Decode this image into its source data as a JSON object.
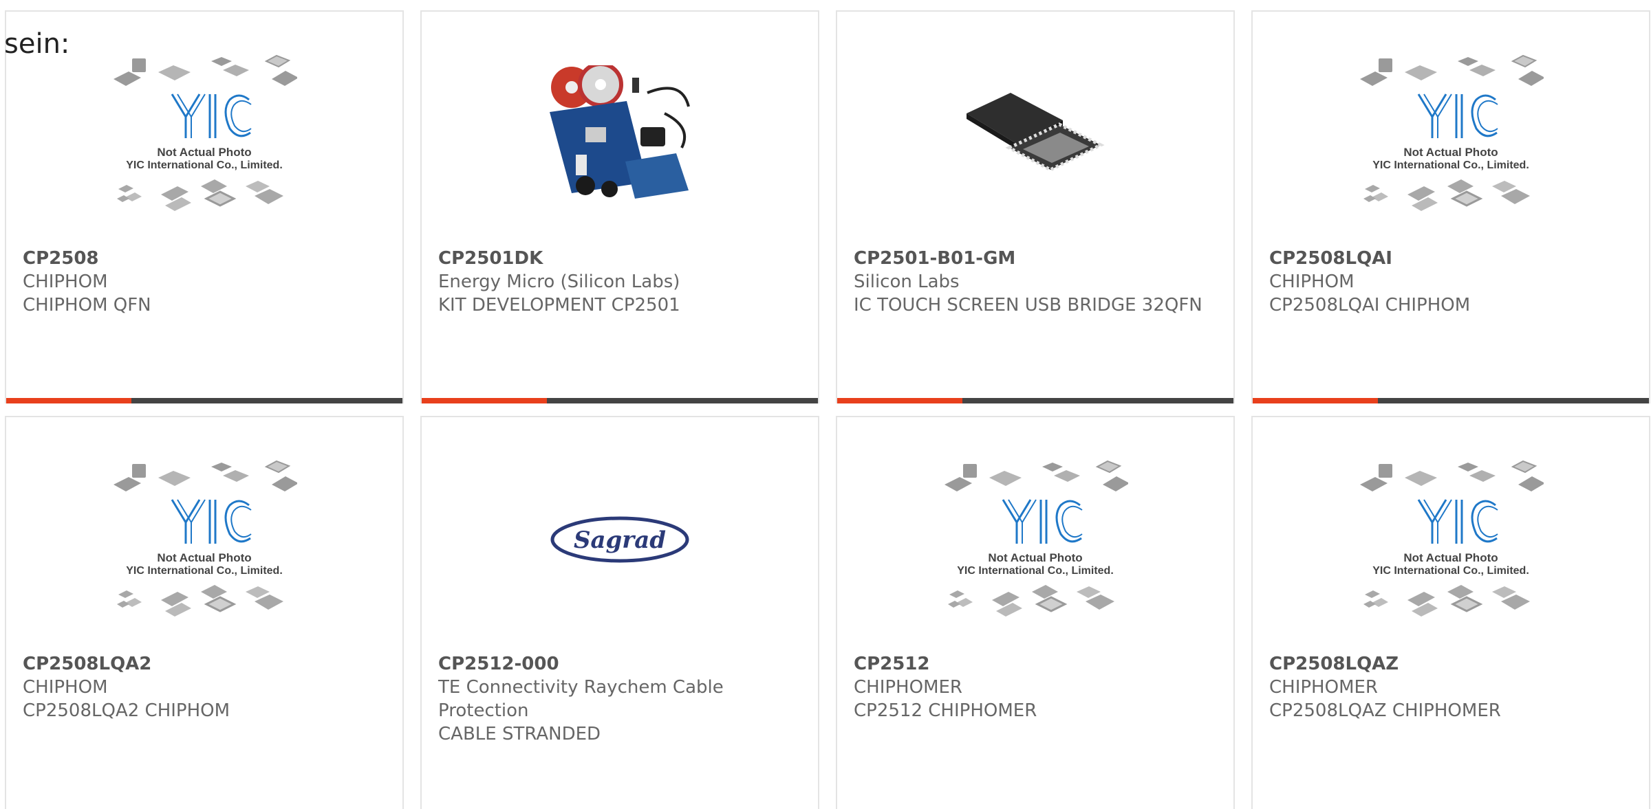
{
  "page": {
    "heading": "sein:"
  },
  "colors": {
    "accent_bar": "#e8401c",
    "bar_base": "#444444",
    "card_border": "#e4e4e4",
    "yic_logo_blue": "#1f78c8",
    "sagrad_logo_navy": "#2b3a78"
  },
  "placeholder": {
    "caption_line1": "Not Actual Photo",
    "caption_line2": "YIC International Co., Limited.",
    "logo_text": "YIC"
  },
  "products": [
    {
      "part_number": "CP2508",
      "manufacturer": "CHIPHOM",
      "description": "CHIPHOM QFN",
      "image": "yic-placeholder-icon"
    },
    {
      "part_number": "CP2501DK",
      "manufacturer": "Energy Micro (Silicon Labs)",
      "description": "KIT DEVELOPMENT CP2501",
      "image": "dev-kit-photo"
    },
    {
      "part_number": "CP2501-B01-GM",
      "manufacturer": "Silicon Labs",
      "description": "IC TOUCH SCREEN USB BRIDGE 32QFN",
      "image": "qfn-chip-photo"
    },
    {
      "part_number": "CP2508LQAI",
      "manufacturer": "CHIPHOM",
      "description": "CP2508LQAI CHIPHOM",
      "image": "yic-placeholder-icon"
    },
    {
      "part_number": "CP2508LQA2",
      "manufacturer": "CHIPHOM",
      "description": "CP2508LQA2 CHIPHOM",
      "image": "yic-placeholder-icon"
    },
    {
      "part_number": "CP2512-000",
      "manufacturer": "TE Connectivity Raychem Cable Protection",
      "description": "CABLE STRANDED",
      "image": "sagrad-logo",
      "logo_text": "Sagrad"
    },
    {
      "part_number": "CP2512",
      "manufacturer": "CHIPHOMER",
      "description": "CP2512 CHIPHOMER",
      "image": "yic-placeholder-icon"
    },
    {
      "part_number": "CP2508LQAZ",
      "manufacturer": "CHIPHOMER",
      "description": "CP2508LQAZ CHIPHOMER",
      "image": "yic-placeholder-icon"
    }
  ]
}
